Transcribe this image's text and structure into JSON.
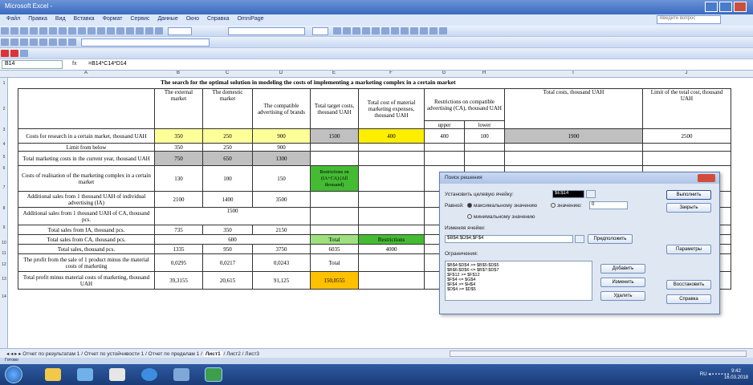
{
  "window": {
    "title": "Microsoft Excel - ",
    "help_placeholder": "Введите вопрос"
  },
  "menu": [
    "Файл",
    "Правка",
    "Вид",
    "Вставка",
    "Формат",
    "Сервис",
    "Данные",
    "Окно",
    "Справка",
    "OmniPage"
  ],
  "formula_bar": {
    "cell_ref": "B14",
    "fx": "fx",
    "formula": "=B14*C14*D14"
  },
  "sheet": {
    "title": "The search for the optimal solution in modeling the costs of implementing a marketing complex in a certain market",
    "headers": {
      "external": "The external market",
      "domestic": "The domestic market",
      "comp_adv": "The compatible advertising of brands",
      "total_target": "Total target costs, thousand UAH",
      "total_material": "Total cost of material marketing expenses, thousand UAH",
      "restrictions": "Restrictions on compatible advertising (CA), thousand UAH",
      "upper": "upper",
      "lower": "lower",
      "total_costs": "Total costs, thousand UAH",
      "limit": "Limit of the total cost, thousand UAH"
    },
    "rows": [
      {
        "label": "Costs for research in a certain market, thousand UAH",
        "a": "350",
        "b": "250",
        "c": "900",
        "d": "1500",
        "e": "400",
        "f": "400",
        "g": "100",
        "h": "1900",
        "i": "2500"
      },
      {
        "label": "Limit from below",
        "a": "350",
        "b": "250",
        "c": "900"
      },
      {
        "label": "Total marketing costs in the current year, thousand UAH",
        "a": "750",
        "b": "650",
        "c": "1300"
      },
      {
        "label": "Costs of realisation of the marketing complex in a certain market",
        "a": "130",
        "b": "100",
        "c": "150",
        "d": "Restrictions on (IA+CA) (All thousand)"
      },
      {
        "label": "Additional sales from 1 thousand UAH of individual advertising (IA)",
        "a": "2100",
        "b": "1400",
        "c": "3500"
      },
      {
        "label": "Additional sales from 1 thousand UAH of CA, thousand pcs.",
        "merged": "1500"
      },
      {
        "label": "Total sales from IA, thousand pcs.",
        "a": "735",
        "b": "350",
        "c": "2150"
      },
      {
        "label": "Total sales from CA, thousand pcs.",
        "merged": "600",
        "d": "Total",
        "e": "Restrictions"
      },
      {
        "label": "Total sales, thousand pcs.",
        "a": "1335",
        "b": "950",
        "c": "3750",
        "d": "6035",
        "e": "4000"
      },
      {
        "label": "The profit from the sale of 1 product minus the material costs of marketing",
        "a": "0,0295",
        "b": "0,0217",
        "c": "0,0243",
        "d": "Total"
      },
      {
        "label": "Total profit minus material costs of marketing, thousand UAH",
        "a": "39,3155",
        "b": "20,615",
        "c": "91,125",
        "d": "150,0555"
      }
    ]
  },
  "solver": {
    "title": "Поиск решения",
    "target_label": "Установить целевую ячейку:",
    "target_value": "$E$14",
    "equal_label": "Равной:",
    "opt_max": "максимальному значению",
    "opt_value": "значению:",
    "value": "0",
    "opt_min": "минимальному значению",
    "changing_label": "Изменяя ячейки:",
    "changing_value": "$B$4:$D$4;$F$4",
    "guess": "Предположить",
    "constraints_label": "Ограничения:",
    "constraints": [
      "$B$4:$D$4 >= $B$5:$D$5",
      "$B$6:$D$6 <= $B$7:$D$7",
      "$F$12 >= $F$12",
      "$F$4 <= $G$4",
      "$F$4 >= $H$4",
      "$D$4 >= $D$5"
    ],
    "btn_solve": "Выполнить",
    "btn_close": "Закрыть",
    "btn_params": "Параметры",
    "btn_add": "Добавить",
    "btn_change": "Изменить",
    "btn_reset": "Восстановить",
    "btn_delete": "Удалить",
    "btn_help": "Справка"
  },
  "tabs": [
    "Отчет по результатам 1",
    "Отчет по устойчивости 1",
    "Отчет по пределам 1",
    "Лист1",
    "Лист2",
    "Лист3"
  ],
  "active_tab": "Лист1",
  "status": "Готово",
  "clock": {
    "time": "9:42",
    "date": "16.03.2018"
  }
}
